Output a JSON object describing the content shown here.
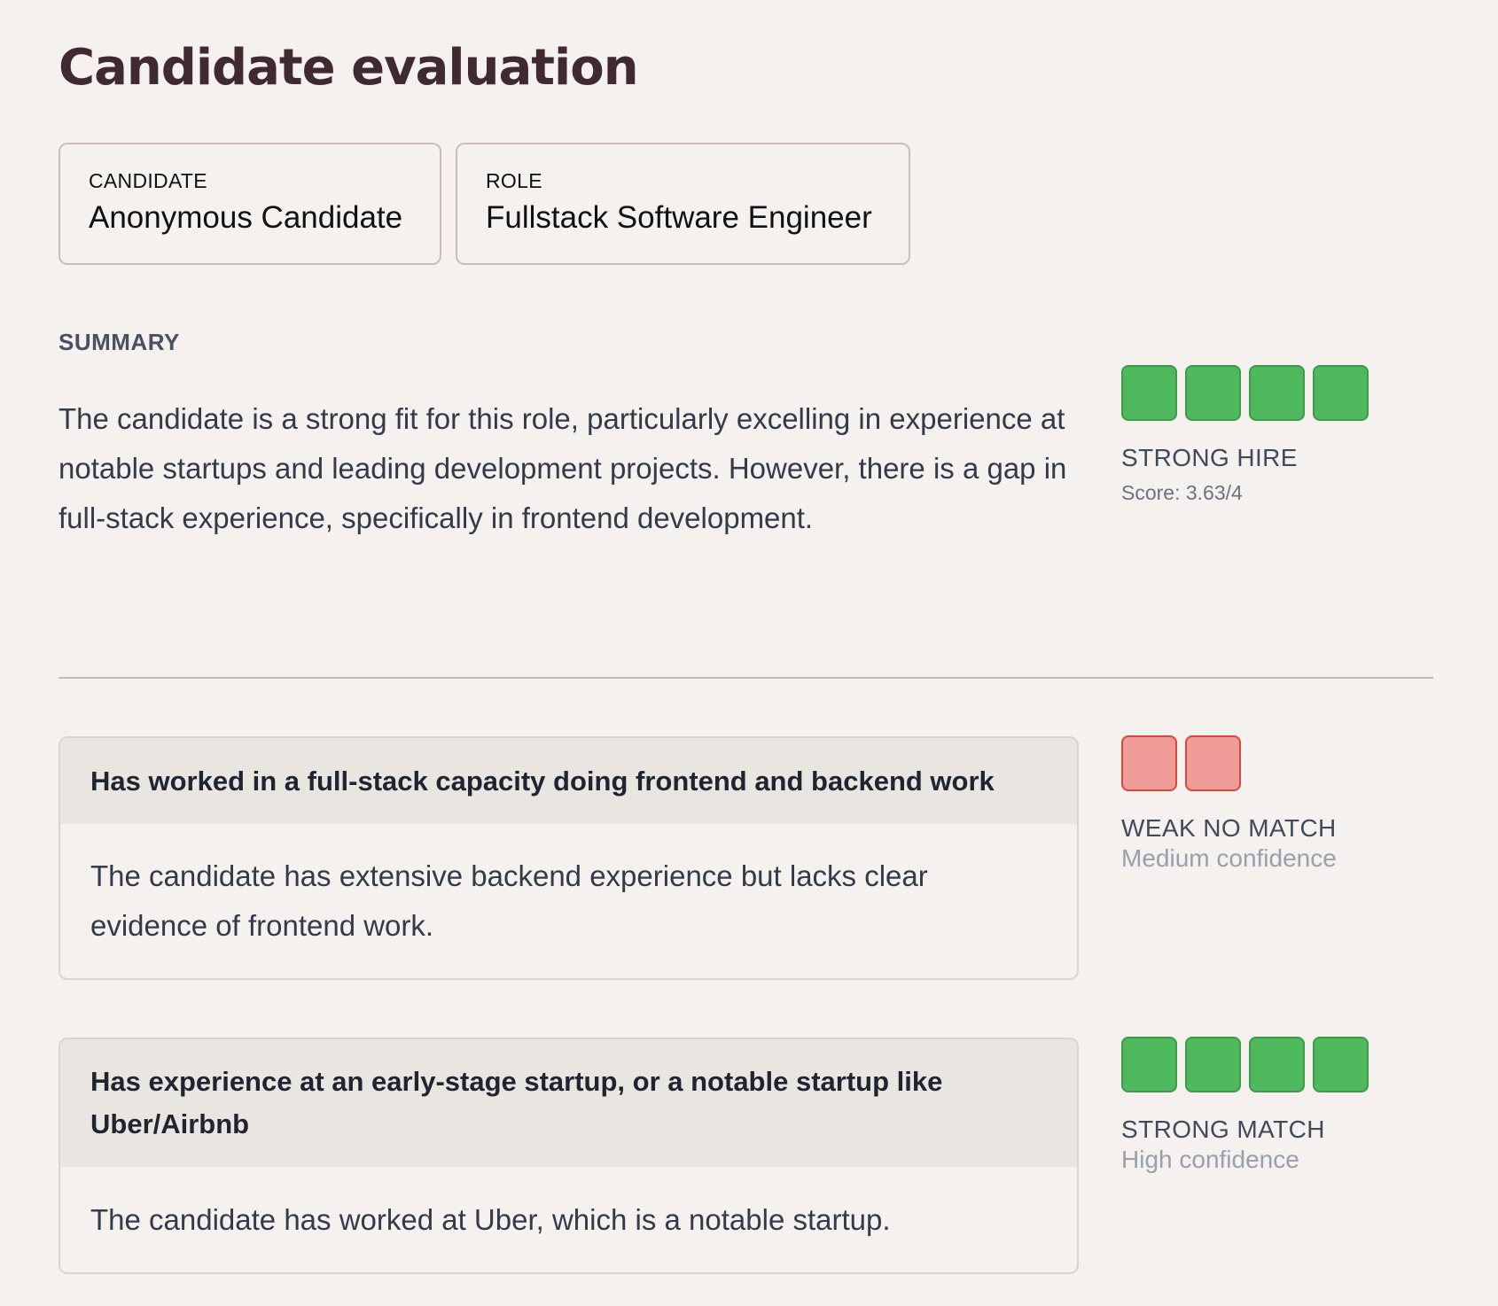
{
  "page": {
    "title": "Candidate evaluation"
  },
  "info": {
    "candidate": {
      "label": "CANDIDATE",
      "value": "Anonymous Candidate"
    },
    "role": {
      "label": "ROLE",
      "value": "Fullstack Software Engineer"
    }
  },
  "summary": {
    "label": "SUMMARY",
    "text": "The candidate is a strong fit for this role, particularly excelling in experience at notable startups and leading development projects. However, there is a gap in full-stack experience, specifically in frontend development.",
    "rating": {
      "label": "STRONG HIRE",
      "score_text": "Score: 3.63/4",
      "filled_squares": 4,
      "max_squares": 4,
      "color": "#50b95e",
      "border_color": "#3e9a4b"
    }
  },
  "criteria": [
    {
      "title": "Has worked in a full-stack capacity doing frontend and backend work",
      "explanation": "The candidate has extensive backend experience but lacks clear evidence of frontend work.",
      "rating": {
        "label": "WEAK NO MATCH",
        "confidence": "Medium confidence",
        "filled_squares": 2,
        "color": "#ef9c99",
        "border_color": "#d9483f"
      }
    },
    {
      "title": "Has experience at an early-stage startup, or a notable startup like Uber/Airbnb",
      "explanation": "The candidate has worked at Uber, which is a notable startup.",
      "rating": {
        "label": "STRONG MATCH",
        "confidence": "High confidence",
        "filled_squares": 4,
        "color": "#50b95e",
        "border_color": "#3e9a4b"
      }
    }
  ]
}
